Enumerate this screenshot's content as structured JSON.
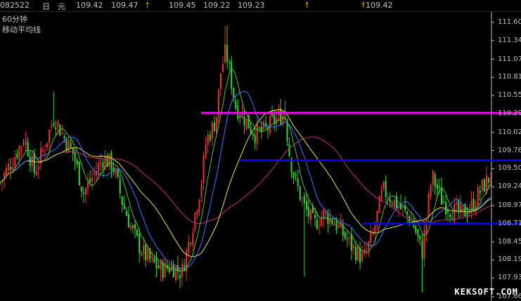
{
  "header": {
    "code": "082522",
    "period_char": "日",
    "unit_char": "元",
    "v1": "109.42",
    "v2": "109.47",
    "arrow": "↑",
    "v3": "109.45",
    "v4": "109.22",
    "v5": "109.23",
    "v6": "109.42"
  },
  "titles": {
    "timeframe": "60分钟",
    "indicator": "移动平均线"
  },
  "watermark": "KEKSOFT.COM",
  "colors": {
    "background": "#000000",
    "candle_up": "#e03030",
    "candle_down": "#30d030",
    "ma_blue": "#3a78ff",
    "ma_green": "#4fc050",
    "ma_yellow": "#e8e840",
    "ma_magenta": "#c0306e",
    "hline_magenta": "#ff00ff",
    "hline_blue": "#0000ff"
  },
  "chart_data": {
    "type": "candlestick",
    "ylim": [
      107.6,
      111.75
    ],
    "yticks": [
      "111.60",
      "111.34",
      "111.07",
      "110.81",
      "110.55",
      "110.29",
      "110.02",
      "109.76",
      "109.50",
      "109.24",
      "108.97",
      "108.71",
      "108.45",
      "108.19",
      "107.93",
      "107.66"
    ],
    "ytick_values": [
      111.6,
      111.34,
      111.07,
      110.81,
      110.55,
      110.29,
      110.02,
      109.76,
      109.5,
      109.24,
      108.97,
      108.71,
      108.45,
      108.19,
      107.93,
      107.66
    ],
    "close_path": [
      [
        0,
        109.3
      ],
      [
        0.02,
        109.55
      ],
      [
        0.05,
        109.95
      ],
      [
        0.07,
        109.45
      ],
      [
        0.09,
        109.8
      ],
      [
        0.11,
        110.25
      ],
      [
        0.13,
        109.95
      ],
      [
        0.15,
        109.7
      ],
      [
        0.17,
        109.15
      ],
      [
        0.19,
        109.4
      ],
      [
        0.21,
        109.65
      ],
      [
        0.23,
        109.55
      ],
      [
        0.25,
        109.0
      ],
      [
        0.27,
        108.6
      ],
      [
        0.29,
        108.3
      ],
      [
        0.31,
        108.15
      ],
      [
        0.33,
        108.05
      ],
      [
        0.35,
        108.1
      ],
      [
        0.37,
        108.0
      ],
      [
        0.39,
        108.6
      ],
      [
        0.41,
        109.3
      ],
      [
        0.42,
        109.9
      ],
      [
        0.44,
        110.2
      ],
      [
        0.45,
        110.9
      ],
      [
        0.46,
        111.2
      ],
      [
        0.48,
        110.4
      ],
      [
        0.5,
        110.2
      ],
      [
        0.52,
        110.0
      ],
      [
        0.54,
        110.05
      ],
      [
        0.56,
        110.2
      ],
      [
        0.58,
        110.3
      ],
      [
        0.59,
        109.7
      ],
      [
        0.6,
        109.35
      ],
      [
        0.62,
        108.95
      ],
      [
        0.64,
        108.7
      ],
      [
        0.66,
        108.85
      ],
      [
        0.68,
        108.75
      ],
      [
        0.7,
        108.55
      ],
      [
        0.72,
        108.35
      ],
      [
        0.74,
        108.2
      ],
      [
        0.76,
        108.55
      ],
      [
        0.78,
        109.2
      ],
      [
        0.8,
        109.05
      ],
      [
        0.82,
        108.9
      ],
      [
        0.84,
        108.75
      ],
      [
        0.86,
        108.3
      ],
      [
        0.88,
        109.4
      ],
      [
        0.9,
        109.05
      ],
      [
        0.92,
        108.9
      ],
      [
        0.94,
        108.85
      ],
      [
        0.96,
        108.95
      ],
      [
        0.98,
        109.2
      ],
      [
        1.0,
        109.4
      ]
    ],
    "lows": [
      [
        0.33,
        107.88
      ],
      [
        0.62,
        107.95
      ],
      [
        0.86,
        107.72
      ]
    ],
    "highs": [
      [
        0.46,
        111.55
      ],
      [
        0.11,
        110.6
      ],
      [
        0.58,
        110.48
      ]
    ],
    "hlines": [
      {
        "value": 110.3,
        "x_start": 0.41,
        "color": "#ff00ff"
      },
      {
        "value": 109.62,
        "x_start": 0.49,
        "color": "#0000ff"
      },
      {
        "value": 108.71,
        "x_start": 0.74,
        "color": "#0000ff"
      }
    ]
  }
}
